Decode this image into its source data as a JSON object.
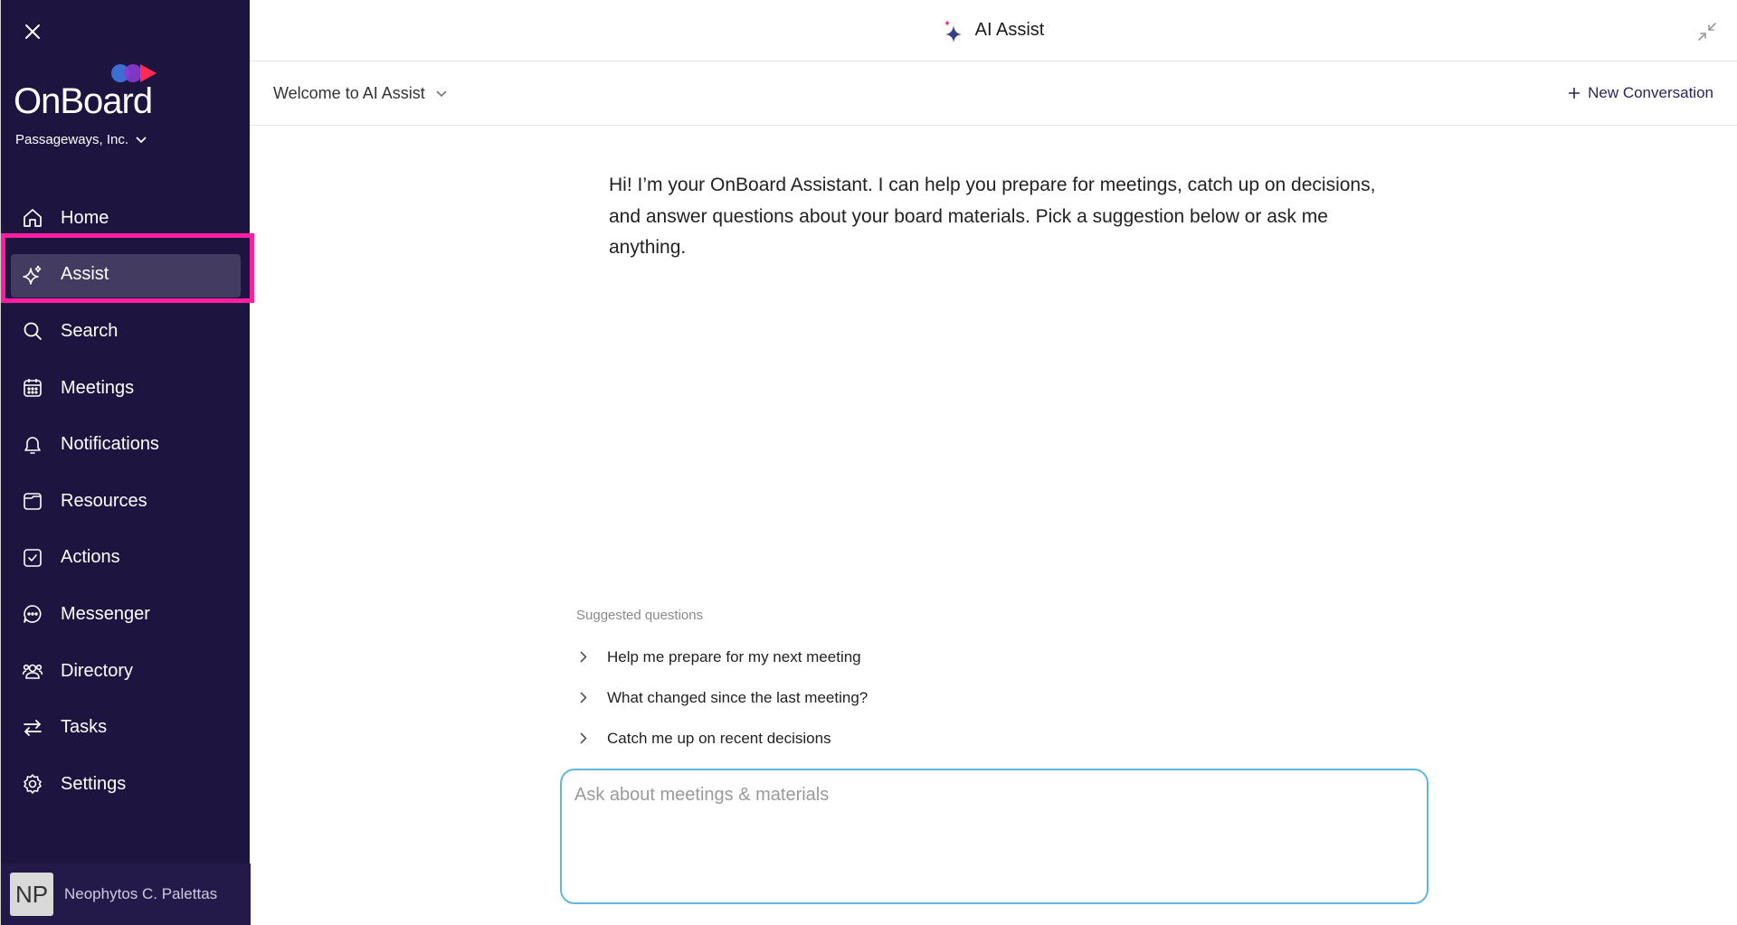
{
  "sidebar": {
    "logo_text": "OnBoard",
    "org_name": "Passageways, Inc.",
    "items": [
      {
        "label": "Home",
        "icon": "home-icon"
      },
      {
        "label": "Assist",
        "icon": "sparkle-icon",
        "active": true
      },
      {
        "label": "Search",
        "icon": "search-icon"
      },
      {
        "label": "Meetings",
        "icon": "calendar-icon"
      },
      {
        "label": "Notifications",
        "icon": "bell-icon"
      },
      {
        "label": "Resources",
        "icon": "folder-icon"
      },
      {
        "label": "Actions",
        "icon": "checkbox-icon"
      },
      {
        "label": "Messenger",
        "icon": "chat-icon"
      },
      {
        "label": "Directory",
        "icon": "people-icon"
      },
      {
        "label": "Tasks",
        "icon": "arrows-swap-icon"
      },
      {
        "label": "Settings",
        "icon": "gear-icon"
      }
    ],
    "user": {
      "initials": "NP",
      "name": "Neophytos C. Palettas"
    }
  },
  "header": {
    "title": "AI Assist"
  },
  "conversation": {
    "selected": "Welcome to AI Assist",
    "new_label": "New Conversation"
  },
  "welcome_message": "Hi! I’m your OnBoard Assistant. I can help you prepare for meetings, catch up on decisions, and answer questions about your board materials. Pick a suggestion below or ask me anything.",
  "suggestions": {
    "title": "Suggested questions",
    "items": [
      "Help me prepare for my next meeting",
      "What changed since the last meeting?",
      "Catch me up on recent decisions"
    ]
  },
  "input": {
    "placeholder": "Ask about meetings & materials",
    "value": ""
  },
  "colors": {
    "sidebar_bg": "#1e1440",
    "active_item_bg": "#433c60",
    "highlight": "#ff1ea0",
    "input_border": "#5fb7df",
    "accent": "#2b2459"
  }
}
